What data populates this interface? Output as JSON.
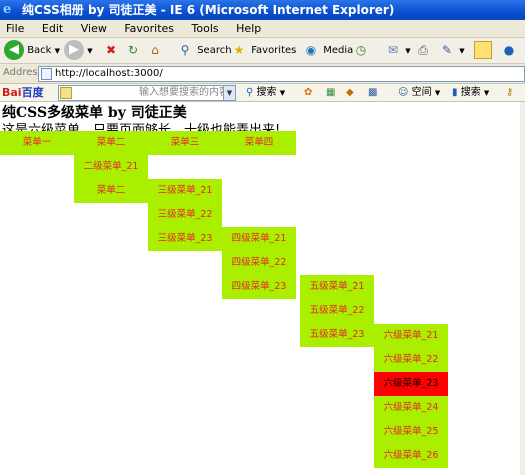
{
  "window": {
    "title": "纯CSS相册 by 司徒正美 - IE 6 (Microsoft Internet Explorer)"
  },
  "menu": [
    "File",
    "Edit",
    "View",
    "Favorites",
    "Tools",
    "Help"
  ],
  "toolbar": {
    "back": "Back",
    "search": "Search",
    "favorites": "Favorites",
    "media": "Media"
  },
  "address": {
    "label": "Address",
    "url": "http://localhost:3000/"
  },
  "baidu": {
    "logo_a": "Bai",
    "logo_b": "百度",
    "placeholder": "输入想要搜索的内容",
    "search": "搜索",
    "space": "空间",
    "search2": "搜索"
  },
  "page": {
    "heading": "纯CSS多级菜单 by 司徒正美",
    "intro": "这是六级菜单，只要页面够长，十级也能弄出来!",
    "menu_bar": [
      "菜单一",
      "菜单二",
      "菜单三",
      "菜单四"
    ],
    "level2": [
      "二级菜单_21",
      "菜单二"
    ],
    "level3": [
      "三级菜单_21",
      "三级菜单_22",
      "三级菜单_23"
    ],
    "level4": [
      "四级菜单_21",
      "四级菜单_22",
      "四级菜单_23"
    ],
    "level5": [
      "五级菜单_21",
      "五级菜单_22",
      "五级菜单_23"
    ],
    "level6": [
      "六级菜单_21",
      "六级菜单_22",
      "六级菜单_23",
      "六级菜单_24",
      "六级菜单_25",
      "六级菜单_26"
    ],
    "active_item": "六级菜单_23"
  },
  "colors": {
    "menu_bg": "#aaee00",
    "menu_text": "#e8282a",
    "active_bg": "#ff0000"
  }
}
